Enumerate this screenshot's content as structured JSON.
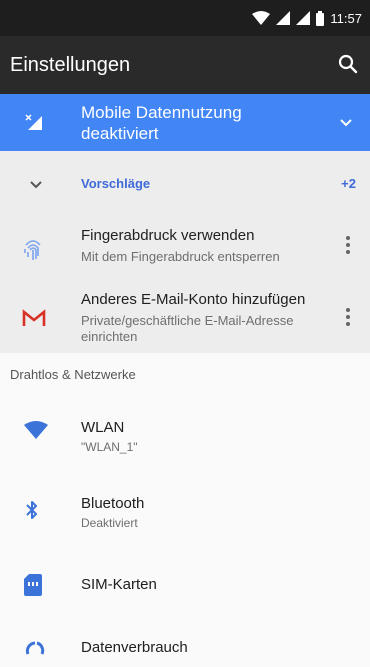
{
  "status_bar": {
    "time": "11:57"
  },
  "app_bar": {
    "title": "Einstellungen"
  },
  "banner": {
    "text": "Mobile Datennutzung deaktiviert"
  },
  "suggestions": {
    "header": "Vorschläge",
    "count": "+2",
    "items": [
      {
        "icon": "fingerprint-icon",
        "title": "Fingerabdruck verwenden",
        "subtitle": "Mit dem Fingerabdruck entsperren"
      },
      {
        "icon": "gmail-icon",
        "title": "Anderes E-Mail-Konto hinzufügen",
        "subtitle": "Private/geschäftliche E-Mail-Adresse einrichten"
      }
    ]
  },
  "section": {
    "title": "Drahtlos & Netzwerke"
  },
  "settings": [
    {
      "icon": "wifi-icon",
      "title": "WLAN",
      "subtitle": "\"WLAN_1\""
    },
    {
      "icon": "bluetooth-icon",
      "title": "Bluetooth",
      "subtitle": "Deaktiviert"
    },
    {
      "icon": "sim-card-icon",
      "title": "SIM-Karten",
      "subtitle": ""
    },
    {
      "icon": "data-usage-icon",
      "title": "Datenverbrauch",
      "subtitle": ""
    }
  ],
  "colors": {
    "accent": "#4285f4",
    "link": "#3f6ad8",
    "gmail_red": "#d93025"
  }
}
